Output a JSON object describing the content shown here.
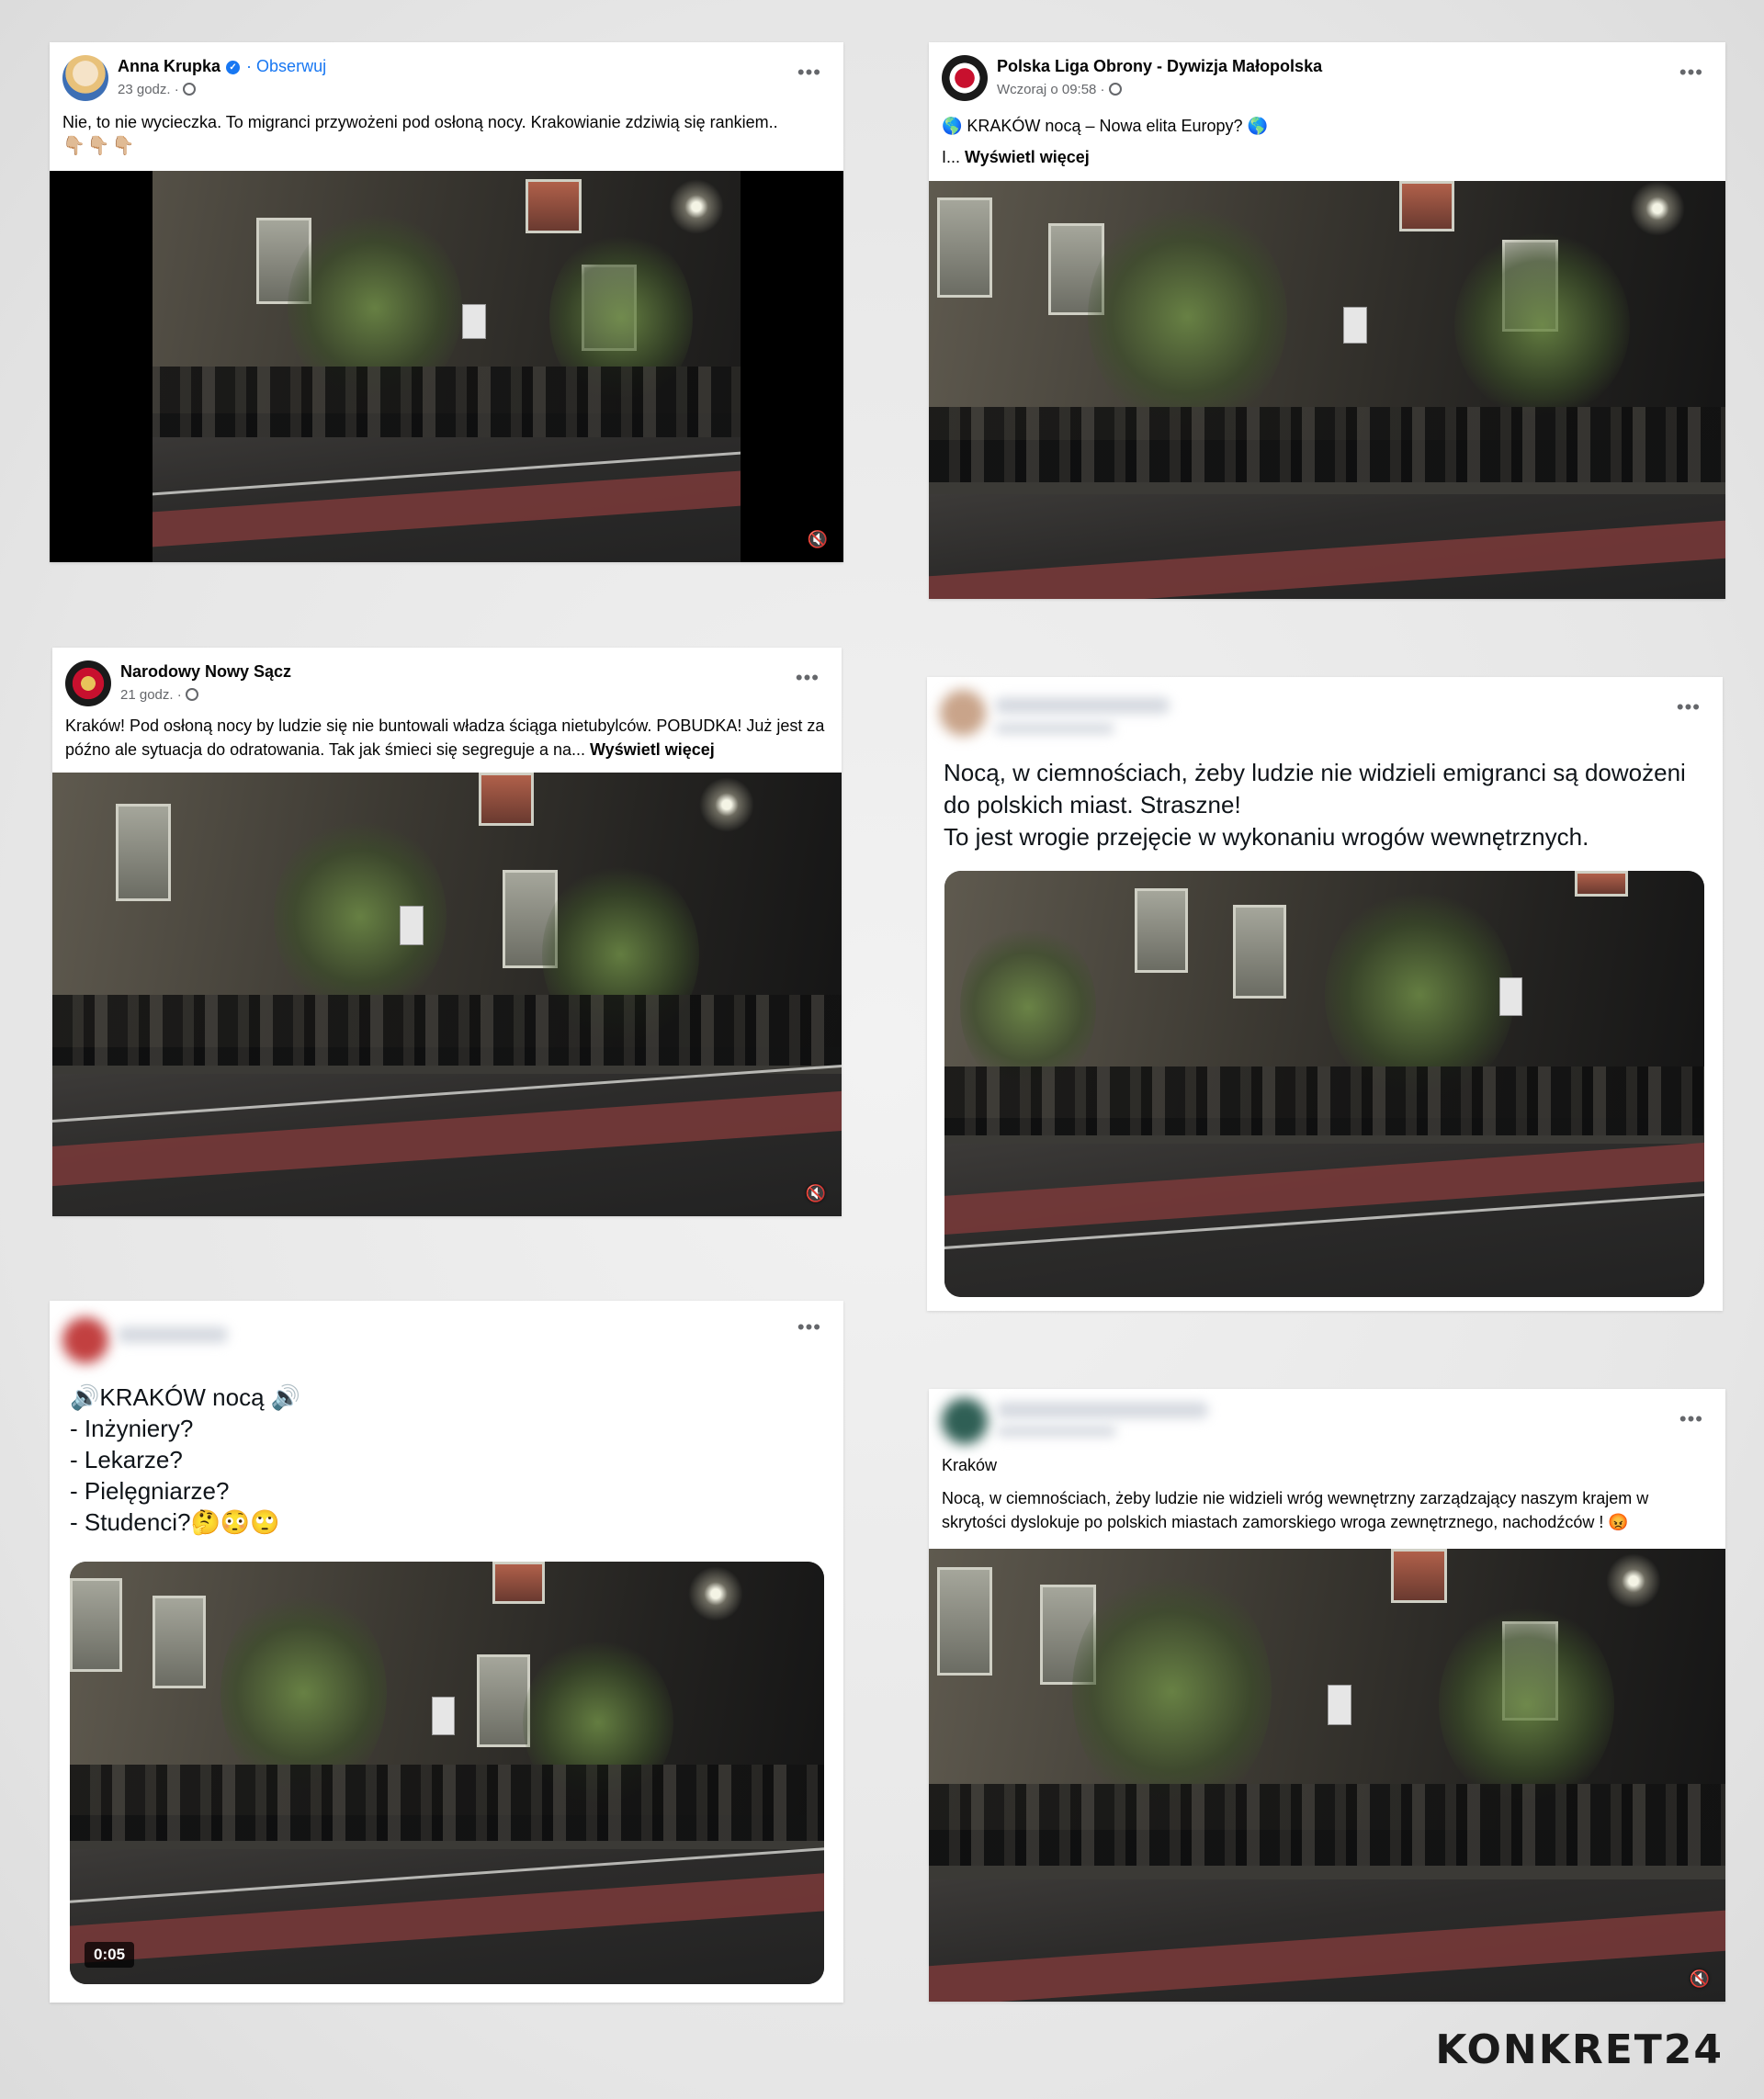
{
  "posts": [
    {
      "author": "Anna Krupka",
      "verified": true,
      "follow_label": "Obserwuj",
      "time": "23 godz.",
      "text": "Nie, to nie wycieczka. To migranci przywożeni pod osłoną nocy. Krakowianie zdziwią się rankiem..",
      "emojis": "👇🏼👇🏼👇🏼",
      "video_mute_icon": "speaker-muted-icon"
    },
    {
      "author": "Polska Liga Obrony - Dywizja Małopolska",
      "time": "Wczoraj o 09:58",
      "text_prefix": "🌎 KRAKÓW nocą – Nowa elita Europy? 🌎",
      "text_line2": "I...",
      "see_more": "Wyświetl więcej"
    },
    {
      "author": "Narodowy Nowy Sącz",
      "time": "21 godz.",
      "text": "Kraków! Pod osłoną nocy by ludzie się nie buntowali władza ściąga nietubylców. POBUDKA! Już jest za późno ale sytuacja do odratowania. Tak jak śmieci się segreguje a na...",
      "see_more": "Wyświetl więcej",
      "video_mute_icon": "speaker-muted-icon"
    },
    {
      "line1": "Nocą, w ciemnościach, żeby ludzie nie widzieli emigranci są dowożeni do polskich miast. Straszne!",
      "line2": "To jest wrogie przejęcie w wykonaniu wrogów wewnętrznych."
    },
    {
      "title": "🔊KRAKÓW nocą 🔊",
      "items": [
        "- Inżyniery?",
        "- Lekarze?",
        "- Pielęgniarze?",
        "- Studenci?🤔😳🙄"
      ],
      "video_duration": "0:05"
    },
    {
      "location": "Kraków",
      "text": "Nocą, w ciemnościach, żeby ludzie nie widzieli wróg wewnętrzny zarządzający naszym krajem w skrytości dyslokuje po polskich miastach zamorskiego wroga zewnętrznego, nachodźców ! 😡",
      "video_mute_icon": "speaker-muted-icon"
    }
  ],
  "menu_dots": "•••",
  "mute_glyph": "🔇",
  "brand": "KONKRET24"
}
